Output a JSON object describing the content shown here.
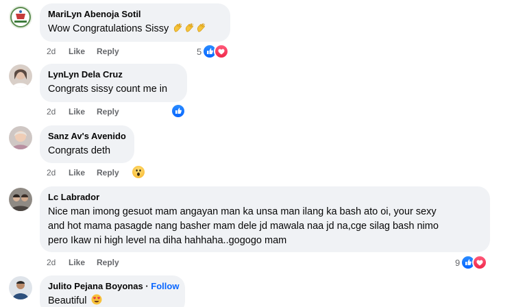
{
  "comments": [
    {
      "author": "MariLyn Abenoja Sotil",
      "text": "Wow Congratulations Sissy",
      "emojis": [
        "clapping-hands",
        "clapping-hands",
        "clapping-hands"
      ],
      "time": "2d",
      "like": "Like",
      "reply": "Reply",
      "reaction_count": "5",
      "reactions": [
        "like",
        "love"
      ]
    },
    {
      "author": "LynLyn Dela Cruz",
      "text": "Congrats sissy count me in",
      "time": "2d",
      "like": "Like",
      "reply": "Reply",
      "reactions": [
        "like"
      ]
    },
    {
      "author": "Sanz Av's Avenido",
      "text": "Congrats deth",
      "time": "2d",
      "like": "Like",
      "reply": "Reply",
      "reactions": [
        "wow"
      ]
    },
    {
      "author": "Lc Labrador",
      "text_lines": [
        "Nice man imong gesuot mam angayan man ka unsa man ilang ka bash ato oi, your sexy",
        "and hot mama pasagde nang basher mam dele jd mawala naa jd na,cge silag bash nimo",
        "pero Ikaw ni high level na diha hahhaha..gogogo mam"
      ],
      "time": "2d",
      "like": "Like",
      "reply": "Reply",
      "reaction_count": "9",
      "reactions": [
        "like",
        "love"
      ]
    },
    {
      "author": "Julito Pejana Boyonas",
      "separator": "·",
      "follow": "Follow",
      "text": "Beautiful",
      "emojis": [
        "heart-eyes"
      ]
    }
  ],
  "colors": {
    "bubble": "#f0f2f5",
    "meta": "#65676b",
    "like_blue": "#0866ff",
    "love_red": "#f0284a"
  }
}
